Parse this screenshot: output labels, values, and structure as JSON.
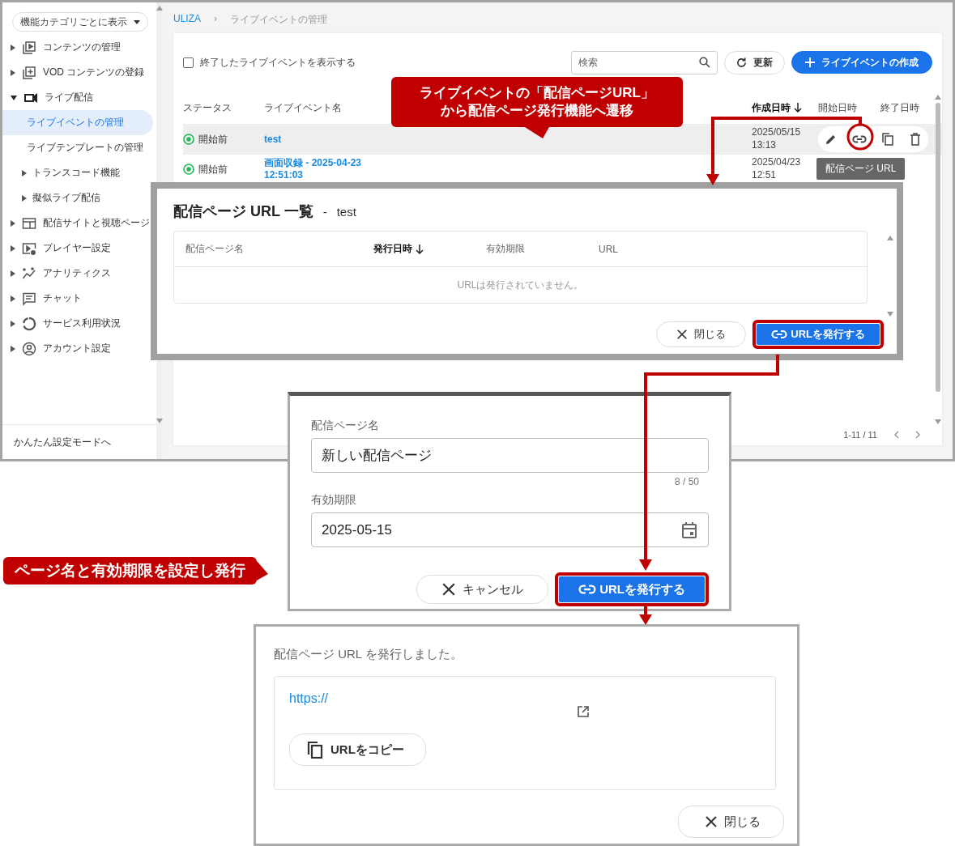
{
  "app": {
    "sidebar": {
      "category_dropdown": "機能カテゴリごとに表示",
      "items": [
        {
          "label": "コンテンツの管理",
          "kind": "group",
          "expanded": false
        },
        {
          "label": "VOD コンテンツの登録",
          "kind": "group",
          "expanded": false
        },
        {
          "label": "ライブ配信",
          "kind": "group",
          "expanded": true,
          "children": [
            {
              "label": "ライブイベントの管理",
              "kind": "page",
              "selected": true
            },
            {
              "label": "ライブテンプレートの管理",
              "kind": "page",
              "selected": false
            },
            {
              "label": "トランスコード機能",
              "kind": "group",
              "expanded": false
            },
            {
              "label": "擬似ライブ配信",
              "kind": "group",
              "expanded": false
            }
          ]
        },
        {
          "label": "配信サイトと視聴ページ",
          "kind": "group",
          "expanded": false
        },
        {
          "label": "プレイヤー設定",
          "kind": "group",
          "expanded": false
        },
        {
          "label": "アナリティクス",
          "kind": "group",
          "expanded": false
        },
        {
          "label": "チャット",
          "kind": "group",
          "expanded": false
        },
        {
          "label": "サービス利用状況",
          "kind": "group",
          "expanded": false
        },
        {
          "label": "アカウント設定",
          "kind": "group",
          "expanded": false
        }
      ],
      "footer_link": "かんたん設定モードへ"
    },
    "breadcrumb": {
      "items": [
        "ULIZA",
        "ライブイベントの管理"
      ],
      "separator": "›"
    },
    "toolbar": {
      "show_ended": {
        "label": "終了したライブイベントを表示する",
        "checked": false
      },
      "search": {
        "placeholder": "検索"
      },
      "refresh": "更新",
      "create": "ライブイベントの作成"
    },
    "table": {
      "columns": [
        {
          "label": "ステータス",
          "sorted": false
        },
        {
          "label": "ライブイベント名",
          "sorted": false
        },
        {
          "label": "作成日時",
          "sorted": true
        },
        {
          "label": "開始日時",
          "sorted": false
        },
        {
          "label": "終了日時",
          "sorted": false
        }
      ],
      "rows": [
        {
          "status": "開始前",
          "name": "test",
          "created": "2025/05/15\n13:13",
          "hovered": true
        },
        {
          "status": "開始前",
          "name": "画面収録 - 2025-04-23\n12:51:03",
          "created": "2025/04/23\n12:51",
          "hovered": false
        }
      ],
      "row_tooltip": "配信ページ URL"
    },
    "pagination": "1-11 / 11"
  },
  "url_list_dialog": {
    "title": "配信ページ URL 一覧",
    "separator": "-",
    "event_name": "test",
    "columns": [
      {
        "label": "配信ページ名",
        "sorted": false
      },
      {
        "label": "発行日時",
        "sorted": true
      },
      {
        "label": "有効期限",
        "sorted": false
      },
      {
        "label": "URL",
        "sorted": false
      }
    ],
    "empty_message": "URLは発行されていません。",
    "buttons": [
      {
        "label": "閉じる",
        "kind": "close",
        "highlighted": false
      },
      {
        "label": "URLを発行する",
        "kind": "issue",
        "highlighted": true
      }
    ]
  },
  "issue_dialog": {
    "fields": [
      {
        "label": "配信ページ名",
        "kind": "text",
        "value": "新しい配信ページ",
        "counter": "8 / 50"
      },
      {
        "label": "有効期限",
        "kind": "date",
        "value": "2025-05-15"
      }
    ],
    "buttons": [
      {
        "label": "キャンセル",
        "kind": "close",
        "highlighted": false
      },
      {
        "label": "URLを発行する",
        "kind": "issue",
        "highlighted": true
      }
    ]
  },
  "result_dialog": {
    "message": "配信ページ URL を発行しました。",
    "url": "https://",
    "copy_button": "URLをコピー",
    "close_button": "閉じる"
  },
  "callouts": [
    {
      "lines": [
        "ライブイベントの「配信ページURL」",
        "から配信ページ発行機能へ遷移"
      ]
    },
    {
      "lines": [
        "ページ名と有効期限を設定し発行"
      ]
    }
  ]
}
